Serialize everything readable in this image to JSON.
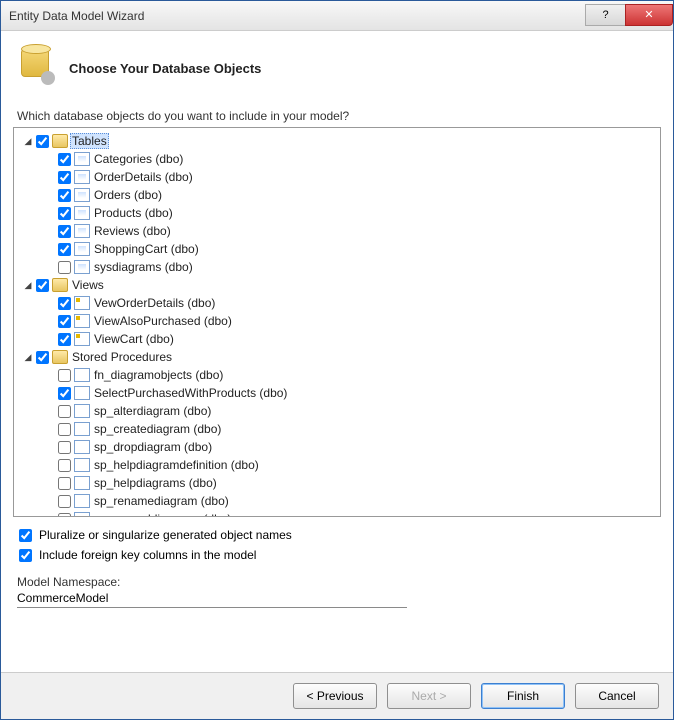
{
  "window": {
    "title": "Entity Data Model Wizard"
  },
  "header": {
    "heading": "Choose Your Database Objects"
  },
  "prompt": "Which database objects do you want to include in your model?",
  "tree": {
    "tables": {
      "label": "Tables",
      "items": [
        {
          "label": "Categories (dbo)",
          "checked": true
        },
        {
          "label": "OrderDetails (dbo)",
          "checked": true
        },
        {
          "label": "Orders (dbo)",
          "checked": true
        },
        {
          "label": "Products (dbo)",
          "checked": true
        },
        {
          "label": "Reviews (dbo)",
          "checked": true
        },
        {
          "label": "ShoppingCart (dbo)",
          "checked": true
        },
        {
          "label": "sysdiagrams (dbo)",
          "checked": false
        }
      ]
    },
    "views": {
      "label": "Views",
      "items": [
        {
          "label": "VewOrderDetails (dbo)",
          "checked": true
        },
        {
          "label": "ViewAlsoPurchased (dbo)",
          "checked": true
        },
        {
          "label": "ViewCart (dbo)",
          "checked": true
        }
      ]
    },
    "sprocs": {
      "label": "Stored Procedures",
      "items": [
        {
          "label": "fn_diagramobjects (dbo)",
          "checked": false
        },
        {
          "label": "SelectPurchasedWithProducts (dbo)",
          "checked": true
        },
        {
          "label": "sp_alterdiagram (dbo)",
          "checked": false
        },
        {
          "label": "sp_creatediagram (dbo)",
          "checked": false
        },
        {
          "label": "sp_dropdiagram (dbo)",
          "checked": false
        },
        {
          "label": "sp_helpdiagramdefinition (dbo)",
          "checked": false
        },
        {
          "label": "sp_helpdiagrams (dbo)",
          "checked": false
        },
        {
          "label": "sp_renamediagram (dbo)",
          "checked": false
        },
        {
          "label": "sp_upgraddiagrams (dbo)",
          "checked": false
        }
      ]
    }
  },
  "options": {
    "pluralize": {
      "label": "Pluralize or singularize generated object names",
      "checked": true
    },
    "foreignKeys": {
      "label": "Include foreign key columns in the model",
      "checked": true
    }
  },
  "namespace": {
    "label": "Model Namespace:",
    "value": "CommerceModel"
  },
  "buttons": {
    "previous": "< Previous",
    "next": "Next >",
    "finish": "Finish",
    "cancel": "Cancel"
  }
}
